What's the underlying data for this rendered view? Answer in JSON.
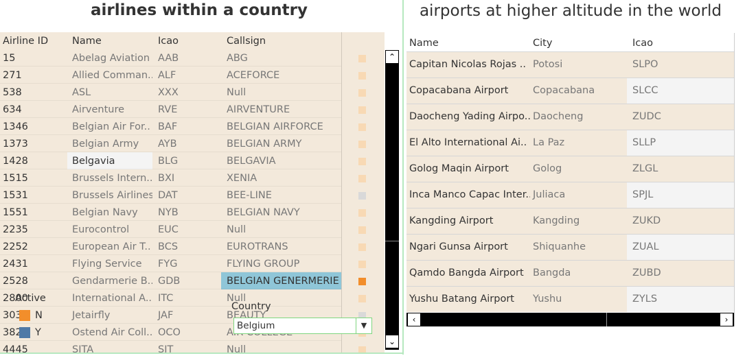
{
  "left": {
    "title": "airlines within a country",
    "headers": {
      "id": "Airline ID",
      "name": "Name",
      "icao": "Icao",
      "callsign": "Callsign"
    },
    "rows": [
      {
        "id": "15",
        "name": "Abelag Aviation",
        "icao": "AAB",
        "callsign": "ABG",
        "active": "N"
      },
      {
        "id": "271",
        "name": "Allied Comman..",
        "icao": "ALF",
        "callsign": "ACEFORCE",
        "active": "N"
      },
      {
        "id": "538",
        "name": "ASL",
        "icao": "XXX",
        "callsign": "Null",
        "active": "N"
      },
      {
        "id": "634",
        "name": "Airventure",
        "icao": "RVE",
        "callsign": "AIRVENTURE",
        "active": "N"
      },
      {
        "id": "1346",
        "name": "Belgian Air For..",
        "icao": "BAF",
        "callsign": "BELGIAN AIRFORCE",
        "active": "N"
      },
      {
        "id": "1373",
        "name": "Belgian Army",
        "icao": "AYB",
        "callsign": "BELGIAN ARMY",
        "active": "N"
      },
      {
        "id": "1428",
        "name": "Belgavia",
        "icao": "BLG",
        "callsign": "BELGAVIA",
        "active": "N"
      },
      {
        "id": "1515",
        "name": "Brussels Intern..",
        "icao": "BXI",
        "callsign": "XENIA",
        "active": "N"
      },
      {
        "id": "1531",
        "name": "Brussels Airlines",
        "icao": "DAT",
        "callsign": "BEE-LINE",
        "active": "Y"
      },
      {
        "id": "1551",
        "name": "Belgian Navy",
        "icao": "NYB",
        "callsign": "BELGIAN NAVY",
        "active": "N"
      },
      {
        "id": "2235",
        "name": "Eurocontrol",
        "icao": "EUC",
        "callsign": "Null",
        "active": "N"
      },
      {
        "id": "2252",
        "name": "European Air T..",
        "icao": "BCS",
        "callsign": "EUROTRANS",
        "active": "N"
      },
      {
        "id": "2431",
        "name": "Flying Service",
        "icao": "FYG",
        "callsign": "FLYING GROUP",
        "active": "N"
      },
      {
        "id": "2528",
        "name": "Gendarmerie B..",
        "icao": "GDB",
        "callsign": "BELGIAN GENERMERIE",
        "active": "N"
      },
      {
        "id": "2800",
        "name": "International A..",
        "icao": "ITC",
        "callsign": "Null",
        "active": "N"
      },
      {
        "id": "303",
        "name": "Jetairfly",
        "icao": "JAF",
        "callsign": "BEAUTY",
        "active": "Y"
      },
      {
        "id": "382",
        "name": "Ostend Air Coll..",
        "icao": "OCO",
        "callsign": "AIR COLLEGE",
        "active": "N"
      },
      {
        "id": "4445",
        "name": "SITA",
        "icao": "SIT",
        "callsign": "Null",
        "active": "N"
      }
    ],
    "highlight_name_row": 6,
    "selected_row": 13,
    "legend": {
      "title": "Active",
      "items": [
        {
          "label": "N",
          "color": "#f28e2b"
        },
        {
          "label": "Y",
          "color": "#4e79a7"
        }
      ]
    },
    "filter": {
      "label": "Country",
      "value": "Belgium"
    }
  },
  "right": {
    "title": "airports at higher altitude in the world",
    "headers": {
      "name": "Name",
      "city": "City",
      "icao": "Icao"
    },
    "rows": [
      {
        "name": "Capitan Nicolas Rojas ..",
        "city": "Potosi",
        "icao": "SLPO"
      },
      {
        "name": "Copacabana Airport",
        "city": "Copacabana",
        "icao": "SLCC"
      },
      {
        "name": "Daocheng Yading Airpo..",
        "city": "Daocheng",
        "icao": "ZUDC"
      },
      {
        "name": "El Alto International Ai..",
        "city": "La Paz",
        "icao": "SLLP"
      },
      {
        "name": "Golog Maqin Airport",
        "city": "Golog",
        "icao": "ZLGL"
      },
      {
        "name": "Inca Manco Capac Inter..",
        "city": "Juliaca",
        "icao": "SPJL"
      },
      {
        "name": "Kangding Airport",
        "city": "Kangding",
        "icao": "ZUKD"
      },
      {
        "name": "Ngari Gunsa Airport",
        "city": "Shiquanhe",
        "icao": "ZUAL"
      },
      {
        "name": "Qamdo Bangda Airport",
        "city": "Bangda",
        "icao": "ZUBD"
      },
      {
        "name": "Yushu Batang Airport",
        "city": "Yushu",
        "icao": "ZYLS"
      }
    ]
  },
  "colors": {
    "row_bg": "#f3e9db",
    "row_alt_icao_bg": "#f4f4f4",
    "selected_cell": "#8fc6d8",
    "mark_light": "#f8d9b4",
    "mark_gray": "#d9d9d9",
    "mark_selected": "#f28e2b"
  }
}
